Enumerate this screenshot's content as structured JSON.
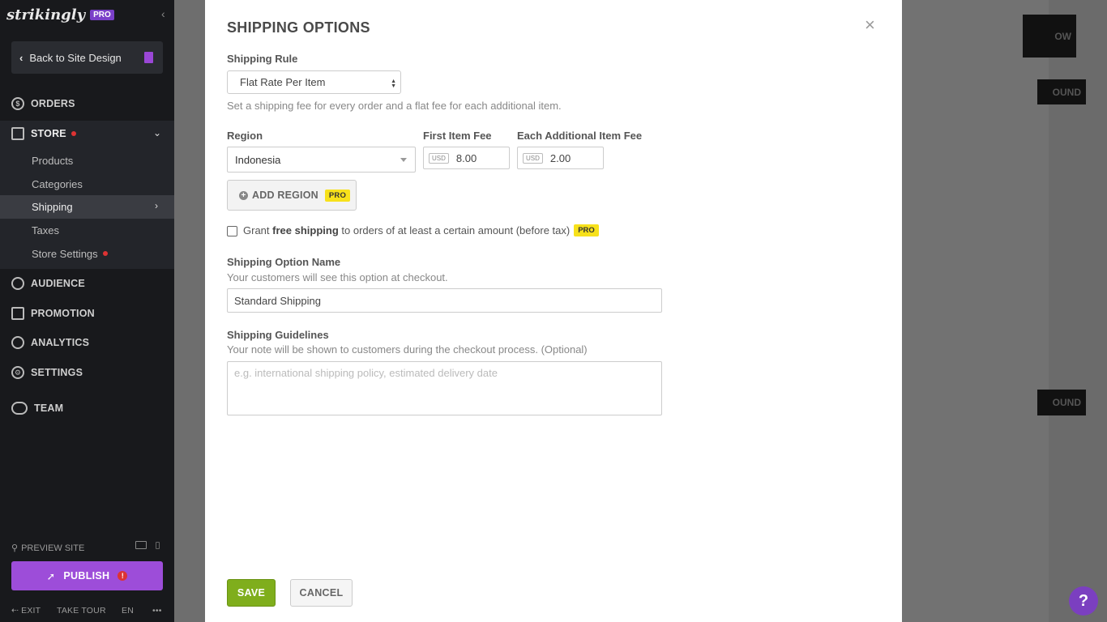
{
  "sidebar": {
    "logo": "strikingly",
    "pro_tag": "PRO",
    "back_label": "Back to Site Design",
    "nav": {
      "orders": "ORDERS",
      "store": "STORE",
      "audience": "AUDIENCE",
      "promotion": "PROMOTION",
      "analytics": "ANALYTICS",
      "settings": "SETTINGS",
      "team": "TEAM"
    },
    "store_items": [
      "Products",
      "Categories",
      "Shipping",
      "Taxes",
      "Store Settings"
    ],
    "preview_site": "PREVIEW SITE",
    "publish_label": "PUBLISH",
    "footer": {
      "exit": "EXIT",
      "take_tour": "TAKE TOUR",
      "lang": "EN",
      "more": "•••"
    }
  },
  "background": {
    "btn1": "OW",
    "btn2": "OUND",
    "btn3": "OUND"
  },
  "modal": {
    "title": "SHIPPING OPTIONS",
    "close": "×",
    "shipping_rule_label": "Shipping Rule",
    "shipping_rule_value": "Flat Rate Per Item",
    "shipping_rule_hint": "Set a shipping fee for every order and a flat fee for each additional item.",
    "region_label": "Region",
    "region_value": "Indonesia",
    "first_fee_label": "First Item Fee",
    "first_fee_currency": "USD",
    "first_fee_value": "8.00",
    "additional_fee_label": "Each Additional Item Fee",
    "additional_fee_currency": "USD",
    "additional_fee_value": "2.00",
    "add_region_label": "ADD REGION",
    "pro_badge": "PRO",
    "free_shipping_pre": "Grant",
    "free_shipping_bold": "free shipping",
    "free_shipping_post": "to orders of at least a certain amount (before tax)",
    "option_name_label": "Shipping Option Name",
    "option_name_hint": "Your customers will see this option at checkout.",
    "option_name_value": "Standard Shipping",
    "guidelines_label": "Shipping Guidelines",
    "guidelines_hint": "Your note will be shown to customers during the checkout process. (Optional)",
    "guidelines_placeholder": "e.g. international shipping policy, estimated delivery date",
    "save_label": "SAVE",
    "cancel_label": "CANCEL"
  },
  "help_label": "?"
}
